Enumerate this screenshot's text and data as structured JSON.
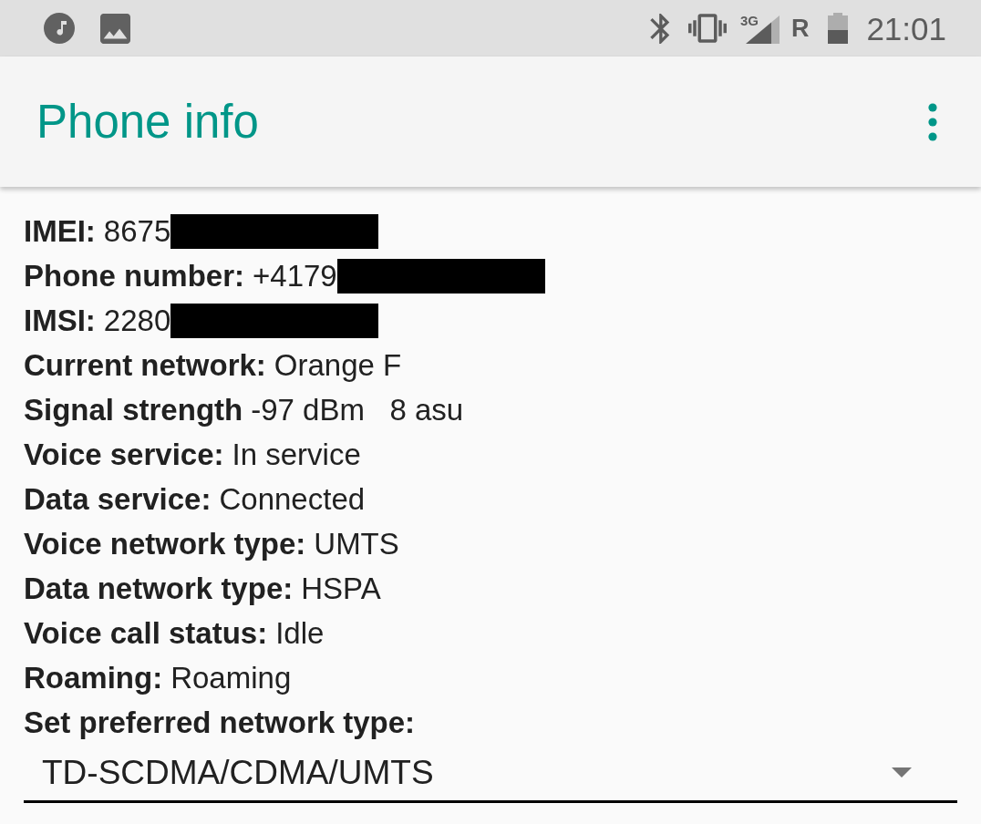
{
  "status_bar": {
    "network_type": "3G",
    "roaming": "R",
    "time": "21:01"
  },
  "app_bar": {
    "title": "Phone info"
  },
  "fields": [
    {
      "label": "IMEI:",
      "value": "8675",
      "redacted": true
    },
    {
      "label": "Phone number:",
      "value": "+4179",
      "redacted": true
    },
    {
      "label": "IMSI:",
      "value": "2280",
      "redacted": true
    },
    {
      "label": "Current network:",
      "value": "Orange F",
      "redacted": false
    },
    {
      "label": "Signal strength",
      "value": "-97 dBm   8 asu",
      "redacted": false
    },
    {
      "label": "Voice service:",
      "value": "In service",
      "redacted": false
    },
    {
      "label": "Data service:",
      "value": "Connected",
      "redacted": false
    },
    {
      "label": "Voice network type:",
      "value": "UMTS",
      "redacted": false
    },
    {
      "label": "Data network type:",
      "value": "HSPA",
      "redacted": false
    },
    {
      "label": "Voice call status:",
      "value": "Idle",
      "redacted": false
    },
    {
      "label": "Roaming:",
      "value": "Roaming",
      "redacted": false
    }
  ],
  "preferred_network": {
    "label": "Set preferred network type:",
    "value": "TD-SCDMA/CDMA/UMTS"
  }
}
